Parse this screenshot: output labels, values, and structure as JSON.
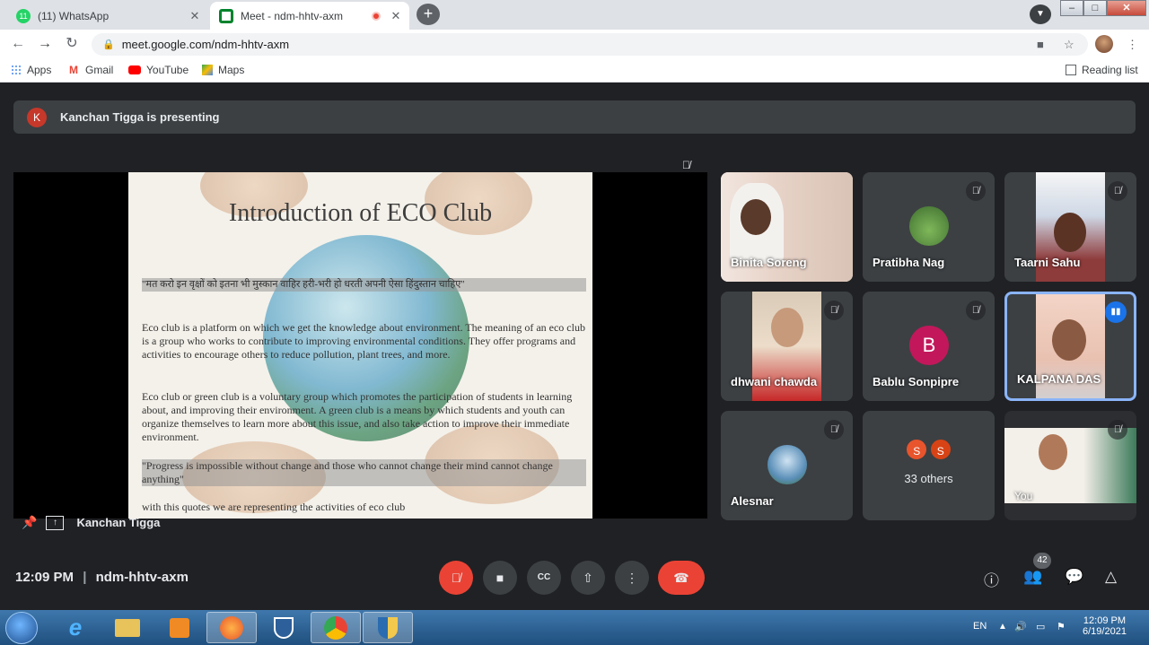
{
  "browser": {
    "tabs": [
      {
        "title": "(11) WhatsApp",
        "favicon_badge": "11",
        "active": false
      },
      {
        "title": "Meet - ndm-hhtv-axm",
        "active": true,
        "recording": true
      }
    ],
    "url": "meet.google.com/ndm-hhtv-axm",
    "bookmarks": [
      "Apps",
      "Gmail",
      "YouTube",
      "Maps"
    ],
    "reading_list": "Reading list"
  },
  "meet": {
    "presenting_banner": "Kanchan Tigga is presenting",
    "presenter_initial": "K",
    "presenter_name": "Kanchan Tigga",
    "slide": {
      "title": "Introduction of ECO Club",
      "quote_hindi": "\"मत करो इन वृक्षों को इतना भी मुस्कान वाहिर हरी-भरी हो धरती अपनी ऐसा हिंदुस्तान चाहिए\"",
      "para1": "Eco club is a platform on which we get the knowledge about environment. The meaning of an eco club is a group who works to contribute to improving environmental conditions. They offer programs and activities to encourage others to reduce pollution, plant trees, and more.",
      "para2": "Eco club or green club is a voluntary group which promotes the participation of students in learning about, and improving their environment. A green club is a means by which students and youth can organize themselves to learn more about this issue, and also take action to improve their immediate environment.",
      "quote_english": "\"Progress is impossible without change and those who cannot change their mind cannot change anything\"",
      "closing": "with this quotes we are representing the activities of  eco club"
    },
    "participants": [
      {
        "name": "Binita Soreng",
        "type": "video",
        "muted": false
      },
      {
        "name": "Pratibha Nag",
        "type": "avatar",
        "muted": true
      },
      {
        "name": "Taarni Sahu",
        "type": "video",
        "muted": true
      },
      {
        "name": "dhwani chawda",
        "type": "video",
        "muted": true
      },
      {
        "name": "Bablu Sonpipre",
        "type": "initial",
        "initial": "B",
        "muted": true
      },
      {
        "name": "KALPANA DAS",
        "type": "video",
        "muted": false,
        "speaking": true
      },
      {
        "name": "Alesnar",
        "type": "avatar",
        "muted": true
      },
      {
        "name": "33 others",
        "type": "others",
        "initials": [
          "S",
          "S"
        ]
      },
      {
        "name": "You",
        "type": "video",
        "muted": true
      }
    ],
    "time": "12:09 PM",
    "meeting_code": "ndm-hhtv-axm",
    "people_count": "42"
  },
  "taskbar": {
    "lang": "EN",
    "time": "12:09 PM",
    "date": "6/19/2021"
  }
}
